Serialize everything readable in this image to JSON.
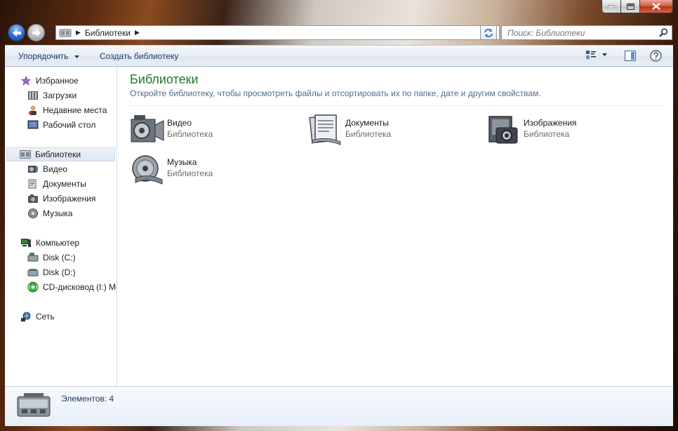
{
  "window": {
    "address": {
      "crumb": "Библиотеки"
    },
    "search": {
      "placeholder": "Поиск: Библиотеки"
    }
  },
  "toolbar": {
    "organize_label": "Упорядочить",
    "new_library_label": "Создать библиотеку"
  },
  "sidebar": {
    "favorites": {
      "label": "Избранное",
      "items": [
        {
          "label": "Загрузки"
        },
        {
          "label": "Недавние места"
        },
        {
          "label": "Рабочий стол"
        }
      ]
    },
    "libraries": {
      "label": "Библиотеки",
      "items": [
        {
          "label": "Видео"
        },
        {
          "label": "Документы"
        },
        {
          "label": "Изображения"
        },
        {
          "label": "Музыка"
        }
      ]
    },
    "computer": {
      "label": "Компьютер",
      "items": [
        {
          "label": "Disk (C:)"
        },
        {
          "label": "Disk (D:)"
        },
        {
          "label": "CD-дисковод (I:) Me"
        }
      ]
    },
    "network": {
      "label": "Сеть"
    }
  },
  "main": {
    "title": "Библиотеки",
    "subtitle": "Откройте библиотеку, чтобы просмотреть файлы и отсортировать их по папке, дате и другим свойствам.",
    "libraries": [
      {
        "name": "Видео",
        "type": "Библиотека"
      },
      {
        "name": "Документы",
        "type": "Библиотека"
      },
      {
        "name": "Изображения",
        "type": "Библиотека"
      },
      {
        "name": "Музыка",
        "type": "Библиотека"
      }
    ]
  },
  "status": {
    "count": "Элементов: 4"
  },
  "colors": {
    "title_green": "#1d7b2f",
    "toolbar_text": "#1e395b",
    "close_red": "#c8412a"
  }
}
